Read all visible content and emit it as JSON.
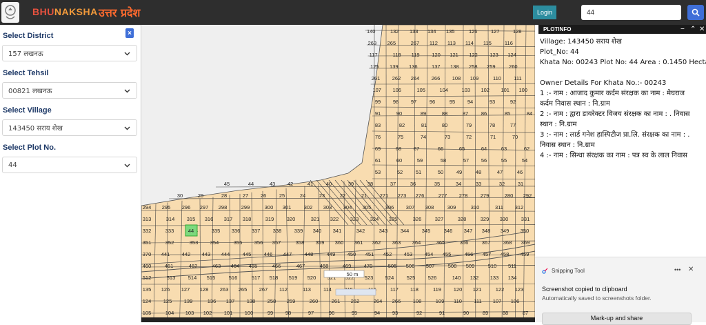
{
  "header": {
    "brand_part1": "BHU",
    "brand_part2": "NAKSHA",
    "state": "उत्तर प्रदेश",
    "login_label": "Login",
    "search_value": "44"
  },
  "sidebar": {
    "district_label": "Select District",
    "district_value": "157 लखनऊ",
    "tehsil_label": "Select Tehsil",
    "tehsil_value": "00821 लखनऊ",
    "village_label": "Select Village",
    "village_value": "143450 सराय शेख",
    "plot_label": "Select Plot No.",
    "plot_value": "44",
    "close_label": "×"
  },
  "plotinfo": {
    "title": "PLOTINFO",
    "lines": [
      "Village: 143450 सराय शेख",
      "Plot_No: 44",
      "Khata No: 00243 Plot No: 44 Area : 0.1450 Hectare",
      "",
      "Owner Details For Khata No.:- 00243",
      "1 :- नाम : आजाद कुमार कर्दम संरक्षक का नाम : मेघराज",
      "कर्दम निवास स्थान : नि.ग्राम",
      "2 :- नाम : द्वारा डायरेक्टर विजय संरक्षक का नाम : . निवास",
      "स्थान : नि.ग्राम",
      "3 :- नाम : लार्ड गनेश हास्पिटीज प्रा.लि. संरक्षक का नाम : .",
      "निवास स्थान : नि.ग्राम",
      "4 :- नाम : सिन्धा संरक्षक का नाम : पत्र स्व के लाल निवास"
    ]
  },
  "snipping": {
    "app": "Snipping Tool",
    "message": "Screenshot copied to clipboard",
    "sub": "Automatically saved to screenshots folder.",
    "button": "Mark-up and share"
  },
  "map": {
    "scale_label": "50 m",
    "plots": [
      "140",
      "132",
      "133",
      "134",
      "135",
      "126",
      "127",
      "128",
      "263",
      "265",
      "267",
      "112",
      "113",
      "114",
      "115",
      "116",
      "117",
      "118",
      "119",
      "120",
      "121",
      "122",
      "123",
      "124",
      "125",
      "139",
      "136",
      "137",
      "138",
      "258",
      "259",
      "260",
      "261",
      "262",
      "264",
      "266",
      "108",
      "109",
      "110",
      "111",
      "107",
      "106",
      "105",
      "104",
      "103",
      "102",
      "101",
      "100",
      "99",
      "98",
      "97",
      "96",
      "95",
      "94",
      "93",
      "92",
      "91",
      "90",
      "89",
      "88",
      "87",
      "86",
      "85",
      "84",
      "83",
      "82",
      "81",
      "80",
      "79",
      "78",
      "77",
      "76",
      "75",
      "74",
      "73",
      "72",
      "71",
      "70",
      "69",
      "68",
      "67",
      "66",
      "65",
      "64",
      "63",
      "62",
      "61",
      "60",
      "59",
      "58",
      "57",
      "56",
      "55",
      "54",
      "53",
      "52",
      "51",
      "50",
      "49",
      "48",
      "47",
      "46",
      "45",
      "44",
      "43",
      "42",
      "41",
      "40",
      "39",
      "38",
      "37",
      "36",
      "35",
      "34",
      "33",
      "32",
      "31",
      "30",
      "29",
      "28",
      "27",
      "26",
      "25",
      "24",
      "23",
      "22",
      "21",
      "271",
      "273",
      "276",
      "277",
      "278",
      "279",
      "280",
      "292",
      "294",
      "295",
      "296",
      "297",
      "298",
      "299",
      "300",
      "301",
      "302",
      "303",
      "304",
      "305",
      "306",
      "307",
      "308",
      "309",
      "310",
      "311",
      "312",
      "313",
      "314",
      "315",
      "316",
      "317",
      "318",
      "319",
      "320",
      "321",
      "322",
      "323",
      "324",
      "325",
      "326",
      "327",
      "328",
      "329",
      "330",
      "331",
      "332",
      "333",
      "334",
      "335",
      "336",
      "337",
      "338",
      "339",
      "340",
      "341",
      "342",
      "343",
      "344",
      "345",
      "346",
      "347",
      "348",
      "349",
      "350",
      "351",
      "352",
      "353",
      "354",
      "355",
      "356",
      "357",
      "358",
      "359",
      "360",
      "361",
      "362",
      "363",
      "364",
      "365",
      "366",
      "367",
      "368",
      "369",
      "370",
      "441",
      "442",
      "443",
      "444",
      "445",
      "446",
      "447",
      "448",
      "449",
      "450",
      "451",
      "452",
      "453",
      "454",
      "455",
      "456",
      "457",
      "458",
      "459",
      "460",
      "461",
      "462",
      "463",
      "464",
      "465",
      "466",
      "467",
      "468",
      "469",
      "470",
      "505",
      "506",
      "507",
      "508",
      "509",
      "510",
      "511",
      "512",
      "513",
      "514",
      "515",
      "516",
      "517",
      "518",
      "519",
      "520",
      "521",
      "522",
      "523",
      "524",
      "525",
      "526"
    ],
    "selected_plot": "44"
  }
}
